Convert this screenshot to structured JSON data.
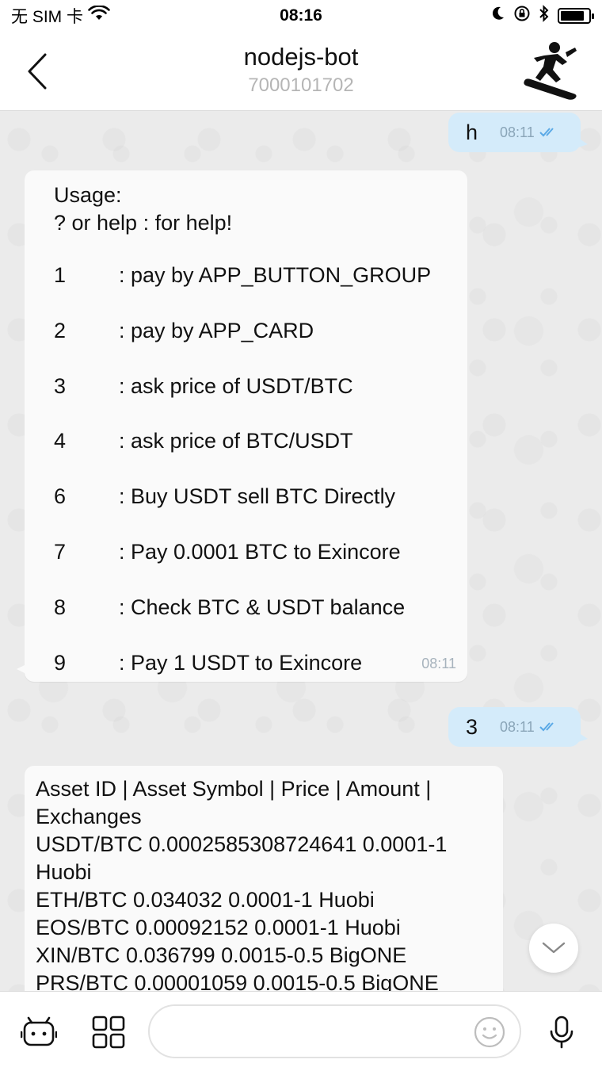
{
  "status_bar": {
    "carrier": "无 SIM 卡",
    "time": "08:16",
    "icons": [
      "wifi-icon",
      "moon-icon",
      "rotation-lock-icon",
      "bluetooth-icon",
      "battery-icon"
    ],
    "battery_level": 0.85
  },
  "header": {
    "title": "nodejs-bot",
    "subtitle": "7000101702",
    "avatar_icon": "snowboarder-icon"
  },
  "messages": {
    "out1": {
      "text": "h",
      "time": "08:11"
    },
    "usage": {
      "header1": "Usage:",
      "header2": "? or help : for help!",
      "commands": [
        {
          "num": "1",
          "desc": ": pay by APP_BUTTON_GROUP"
        },
        {
          "num": "2",
          "desc": ": pay by APP_CARD"
        },
        {
          "num": "3",
          "desc": ": ask price of USDT/BTC"
        },
        {
          "num": "4",
          "desc": ": ask price of BTC/USDT"
        },
        {
          "num": "6",
          "desc": ": Buy USDT sell BTC Directly"
        },
        {
          "num": "7",
          "desc": ": Pay 0.0001 BTC to Exincore"
        },
        {
          "num": "8",
          "desc": ": Check BTC & USDT balance"
        },
        {
          "num": "9",
          "desc": ": Pay 1 USDT to Exincore"
        }
      ],
      "time": "08:11"
    },
    "out2": {
      "text": "3",
      "time": "08:11"
    },
    "prices": {
      "lines": [
        "Asset ID | Asset Symbol | Price | Amount |",
        "Exchanges",
        "USDT/BTC 0.0002585308724641 0.0001-1",
        "Huobi",
        "ETH/BTC 0.034032 0.0001-1 Huobi",
        "EOS/BTC 0.00092152 0.0001-1 Huobi",
        "XIN/BTC 0.036799 0.0015-0.5 BigONE",
        "PRS/BTC 0.00001059 0.0015-0.5 BigONE"
      ]
    }
  },
  "composer": {
    "placeholder": "",
    "icons": [
      "bot-icon",
      "apps-grid-icon",
      "emoji-icon",
      "microphone-icon"
    ]
  },
  "colors": {
    "outgoing_bubble": "#d4ebfa",
    "incoming_bubble": "#fafafa",
    "read_check": "#5aa9e6"
  }
}
